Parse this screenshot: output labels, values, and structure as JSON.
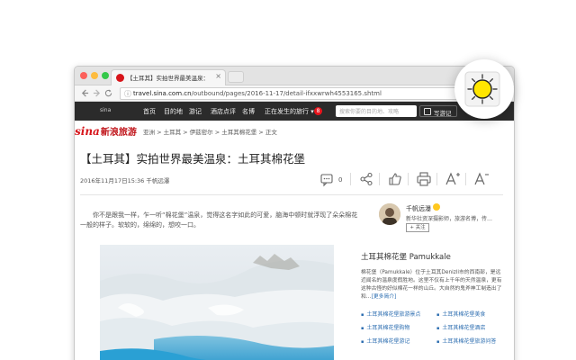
{
  "browser": {
    "tab_title": "【土耳其】实拍世界最美温泉：",
    "tab_close": "×",
    "url_host": "travel.sina.com.cn",
    "url_path": "/outbound/pages/2016-11-17/detail-ifxxwrwh4553165.shtml",
    "back_icon": "arrow-left-icon",
    "forward_icon": "arrow-right-icon",
    "reload_icon": "reload-icon"
  },
  "topnav": {
    "logo": "sina",
    "logo_sub": "新浪旅游",
    "items": [
      "首页",
      "目的地",
      "游记",
      "酒店点评",
      "名博",
      "正在发生的旅行 ▾"
    ],
    "badge": "8",
    "search_placeholder": "搜索你要的目的地、攻略",
    "write_label": "写游记"
  },
  "breadcrumb": {
    "logo_main": "sina",
    "logo_sub": "新浪旅游",
    "path": "亚洲 > 土耳其 > 伊兹密尔 > 土耳其棉花堡 > 正文"
  },
  "article": {
    "title": "【土耳其】实拍世界最美温泉：土耳其棉花堡",
    "meta": "2016年11月17日15:36 千帆远瀑",
    "comment_count": "0",
    "lead": "你不是跟我一样，乍一听“棉花堡”温泉，觉得这名字如此的可爱，脑海中顿时就浮现了朵朵棉花一般的样子。软软的，绵绵的，想咬一口。"
  },
  "author": {
    "name": "千帆远瀑",
    "desc": "新华社资深摄影师，旅游名博，传…",
    "follow": "+ 关注"
  },
  "sidebar": {
    "title": "土耳其棉花堡 Pamukkale",
    "desc": "棉花堡（Pamukkale）位于土耳其Denizli市的西南部，是远近闻名的温泉度假胜地。这里不仅有上千年的天然温泉，更有这种古怪的好似棉花一样的山丘。大自然的鬼斧神工制造出了和…",
    "more": "[更多简介]",
    "links": [
      "土耳其棉花堡旅游景点",
      "土耳其棉花堡美食",
      "土耳其棉花堡购物",
      "土耳其棉花堡酒店",
      "土耳其棉花堡游记",
      "土耳其棉花堡旅游问答"
    ]
  },
  "colors": {
    "brand_red": "#d7141a",
    "nav_dark": "#2b2b2b",
    "link_blue": "#2b6db0",
    "extension_yellow": "#ffe600"
  }
}
